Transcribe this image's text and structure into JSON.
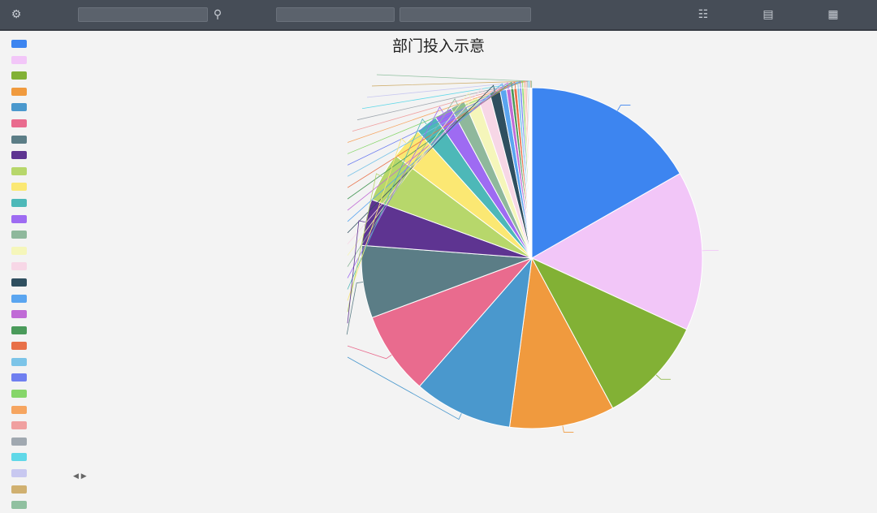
{
  "toolbar": {
    "buttons": [
      {
        "icon": "settings-icon",
        "label": ""
      },
      {
        "icon": "filter-icon",
        "label": ""
      },
      {
        "icon": "download-icon",
        "label": ""
      },
      {
        "icon": "fullscreen-icon",
        "label": ""
      }
    ],
    "search_value": "",
    "search_icon": "search-icon",
    "field_label": "",
    "field_value": "",
    "empty_field_value": ""
  },
  "chart_data": {
    "type": "pie",
    "title": "部门投入示意",
    "show_legend": true,
    "legend_position": "left",
    "categories": [
      "",
      "",
      "",
      "",
      "",
      "",
      "",
      "",
      "",
      "",
      "",
      "",
      "",
      "",
      "",
      "",
      "",
      "",
      "",
      "",
      "",
      "",
      "",
      "",
      "",
      "",
      "",
      "",
      "",
      ""
    ],
    "values": [
      16.8,
      15.2,
      10.3,
      10.0,
      9.4,
      7.9,
      6.9,
      4.4,
      4.7,
      3.1,
      2.1,
      1.7,
      1.4,
      1.3,
      1.2,
      1.0,
      0.6,
      0.4,
      0.3,
      0.3,
      0.25,
      0.2,
      0.2,
      0.15,
      0.15,
      0.12,
      0.1,
      0.1,
      0.08,
      0.05
    ],
    "colors": [
      "#3d85f0",
      "#f2c6f8",
      "#82b135",
      "#f09a3e",
      "#4a98cd",
      "#e96b8e",
      "#5b7d86",
      "#5e3491",
      "#b7d76b",
      "#fbe873",
      "#4db8b8",
      "#9e6bf2",
      "#8fb89c",
      "#f5f6ba",
      "#f7d7e6",
      "#2f4f5f",
      "#5aa5f0",
      "#c06bd6",
      "#4a9a5a",
      "#e87048",
      "#7cc4e8",
      "#6f7ff0",
      "#86d66a",
      "#f6a560",
      "#f0a0a0",
      "#a0a8b0",
      "#60d8e8",
      "#c8c8f0",
      "#d0b070",
      "#90c0a0"
    ]
  }
}
